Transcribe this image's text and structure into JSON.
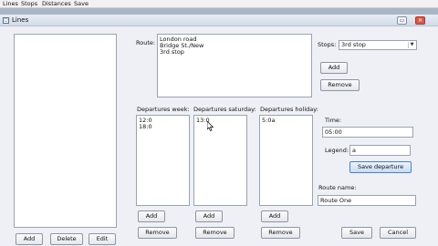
{
  "menu": {
    "items": [
      "Lines",
      "Stops",
      "Distances",
      "Save"
    ]
  },
  "window": {
    "title": "Lines",
    "buttons": [
      "▭",
      "✕"
    ]
  },
  "left_panel": {
    "buttons": {
      "add": "Add",
      "delete": "Delete",
      "edit": "Edit"
    }
  },
  "route": {
    "label": "Route:",
    "stops": [
      "London road",
      "Bridge St./New",
      "3rd stop"
    ]
  },
  "stops": {
    "label": "Stops:",
    "selected": "3rd stop",
    "add": "Add",
    "remove": "Remove"
  },
  "departures": [
    {
      "label": "Departures week:",
      "items": [
        "12:0",
        "18:0"
      ],
      "add": "Add",
      "remove": "Remove"
    },
    {
      "label": "Departures saturday:",
      "items": [
        "13:0"
      ],
      "add": "Add",
      "remove": "Remove"
    },
    {
      "label": "Departures holiday:",
      "items": [
        "5:0a"
      ],
      "add": "Add",
      "remove": "Remove"
    }
  ],
  "time": {
    "label": "Time:",
    "value": "05:00"
  },
  "legend": {
    "label": "Legend:",
    "value": "a"
  },
  "save_departure": "Save departure",
  "route_name": {
    "label": "Route name:",
    "value": "Route One"
  },
  "footer": {
    "save": "Save",
    "cancel": "Cancel"
  }
}
